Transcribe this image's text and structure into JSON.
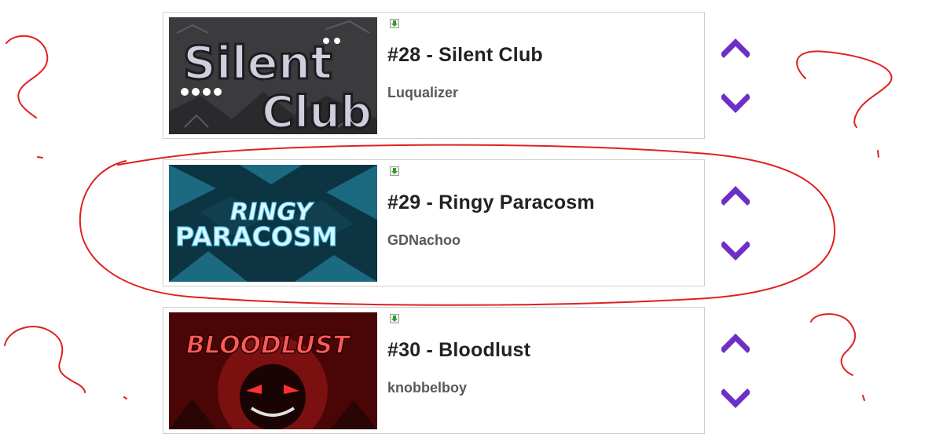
{
  "levels": [
    {
      "rank_title": "#28 - Silent Club",
      "creator": "Luqualizer",
      "thumbnail": {
        "text_line1": "Silent",
        "text_line2": "Club",
        "bg": "#3a3a3c",
        "fg": "#c9c9d6",
        "glow": "#7b6bd6"
      }
    },
    {
      "rank_title": "#29 - Ringy Paracosm",
      "creator": "GDNachoo",
      "thumbnail": {
        "text_line1": "RINGY",
        "text_line2": "PARACOSM",
        "bg": "#0f3a47",
        "fg": "#dff4ff",
        "glow": "#3fc4e8"
      }
    },
    {
      "rank_title": "#30 - Bloodlust",
      "creator": "knobbelboy",
      "thumbnail": {
        "text_line1": "BLOODLUST",
        "bg": "#5a0808",
        "fg": "#ff5a5a",
        "glow": "#ff2a2a"
      }
    }
  ],
  "icons": {
    "vote_up": "chevron-up-icon",
    "vote_down": "chevron-down-icon",
    "download": "download-arrow-icon"
  },
  "colors": {
    "vote_purple": "#6d2fc6",
    "annotation_red": "#e02020",
    "download_green": "#2e9e2e"
  }
}
